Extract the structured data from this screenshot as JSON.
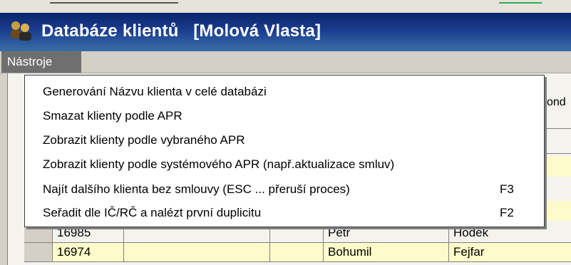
{
  "window": {
    "title": "Databáze klientů",
    "user": "[Molová Vlasta]"
  },
  "menubar": {
    "active_menu": "Nástroje"
  },
  "dropdown": {
    "items": [
      {
        "label": "Generování Názvu klienta v celé databázi",
        "shortcut": ""
      },
      {
        "label": "Smazat klienty podle APR",
        "shortcut": ""
      },
      {
        "label": "Zobrazit klienty podle vybraného APR",
        "shortcut": ""
      },
      {
        "label": "Zobrazit klienty podle systémového APR (např.aktualizace smluv)",
        "shortcut": ""
      },
      {
        "label": "Najít dalšího klienta bez smlouvy (ESC ... přeruší proces)",
        "shortcut": "F3"
      },
      {
        "label": "Seřadit dle IČ/RČ a nalézt první duplicitu",
        "shortcut": "F2"
      }
    ]
  },
  "background": {
    "partial_label": "ond",
    "rows": [
      {
        "id": "16985",
        "first_name": "Petr",
        "last_name": "Hodek"
      },
      {
        "id": "16974",
        "first_name": "Bohumil",
        "last_name": "Fejfar"
      }
    ]
  },
  "colors": {
    "title_gradient_start": "#0a246a",
    "title_gradient_end": "#3a6ea5",
    "menu_highlight": "#6f6f6f",
    "row_highlight": "#fdfbc9"
  },
  "icons": {
    "app": "users-icon"
  }
}
